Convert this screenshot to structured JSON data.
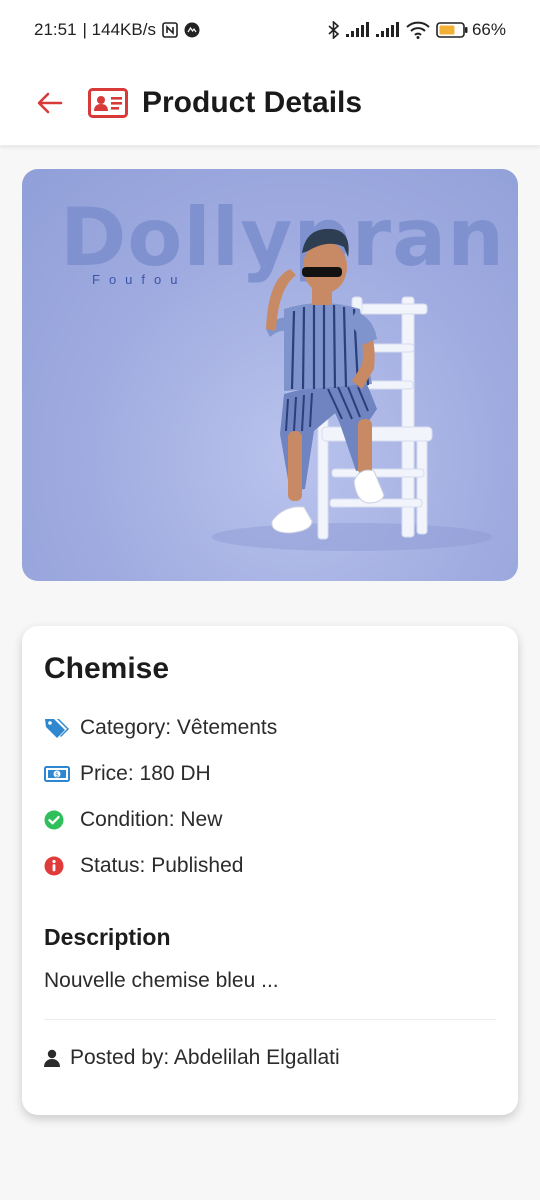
{
  "status_bar": {
    "time": "21:51",
    "network_speed": "| 144KB/s",
    "battery": "66%"
  },
  "app_bar": {
    "title": "Product Details"
  },
  "product_image": {
    "brand": "Dollypran",
    "brand_sub": "Foufou"
  },
  "product": {
    "name": "Chemise",
    "category": "Category: Vêtements",
    "price": "Price: 180 DH",
    "condition": "Condition: New",
    "status": "Status: Published",
    "description_title": "Description",
    "description": "Nouvelle chemise bleu ...",
    "posted_by": "Posted by: Abdelilah Elgallati"
  },
  "colors": {
    "accent_red": "#d83a3a",
    "tag_blue": "#2f87d0",
    "check_green": "#2fbf5b",
    "info_red": "#e03a3a"
  }
}
